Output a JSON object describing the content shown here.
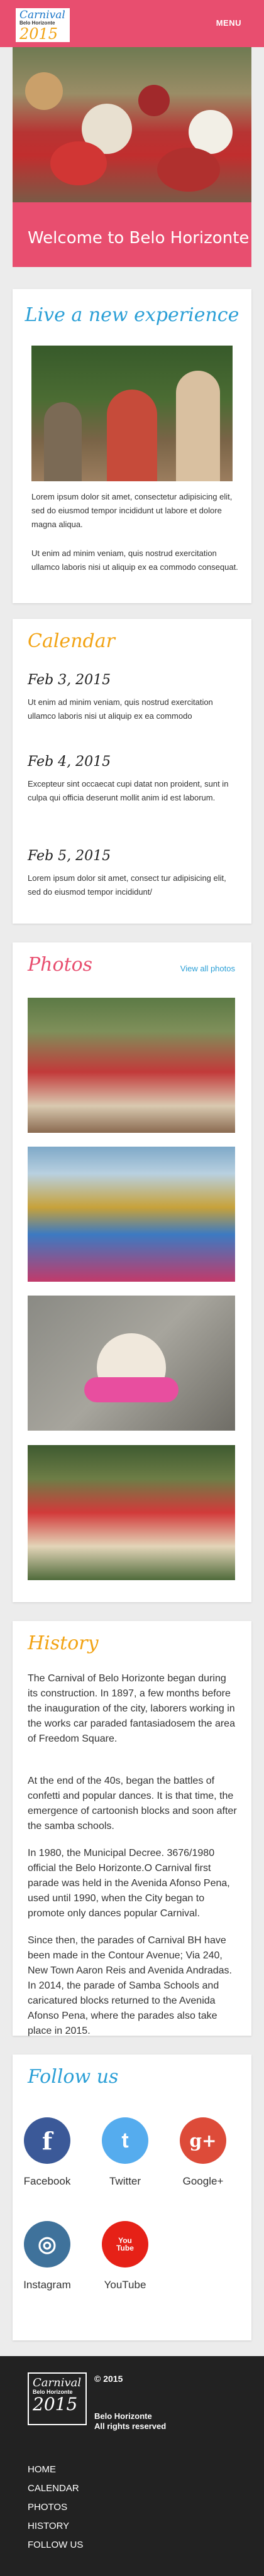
{
  "header": {
    "logo_line1": "Carnival",
    "logo_line2": "Belo Horizonte",
    "logo_line3": "2015",
    "menu_label": "MENU"
  },
  "hero": {
    "title": "Welcome to Belo Horizonte"
  },
  "live": {
    "title": "Live a new experience",
    "paragraphs": [
      "Lorem ipsum dolor sit amet, consectetur adipisicing elit, sed do eiusmod tempor incididunt ut labore et dolore magna aliqua.",
      "Ut enim ad minim veniam, quis nostrud exercitation ullamco laboris nisi ut aliquip ex ea commodo consequat."
    ]
  },
  "calendar": {
    "title": "Calendar",
    "events": [
      {
        "date": "Feb 3, 2015",
        "text": "Ut enim ad minim veniam, quis nostrud exercitation ullamco laboris nisi ut aliquip ex ea commodo"
      },
      {
        "date": "Feb 4, 2015",
        "text": "Excepteur sint occaecat cupi datat non proident, sunt in culpa qui officia deserunt mollit anim id est laborum."
      },
      {
        "date": "Feb 5, 2015",
        "text": "Lorem ipsum dolor sit amet, consect tur adipisicing elit, sed do eiusmod tempor incididunt/"
      }
    ]
  },
  "photos": {
    "title": "Photos",
    "view_all": "View all photos"
  },
  "history": {
    "title": "History",
    "paragraphs": [
      "The Carnival of Belo Horizonte began during its construction. In 1897, a few months before the inauguration of the city, laborers working in the works car paraded fantasiadosem the area of Freedom Square.",
      "At the end of the 40s, began the battles of confetti and popular dances. It is that time, the emergence of cartoonish blocks and soon after the samba schools.",
      "In 1980, the Municipal Decree. 3676/1980 official the Belo Horizonte.O Carnival first parade was held in the Avenida Afonso Pena, used until 1990, when the City began to promote only dances popular Carnival.",
      "Since then, the parades of Carnival BH have been made in the Contour Avenue; Via 240, New Town Aaron Reis and Avenida Andradas. In 2014, the parade of Samba Schools and caricatured blocks returned to the Avenida Afonso Pena, where the parades also take place in 2015."
    ]
  },
  "follow": {
    "title": "Follow us",
    "networks": [
      {
        "label": "Facebook",
        "glyph": "f",
        "color": "#3b5998",
        "icon": "facebook-icon"
      },
      {
        "label": "Twitter",
        "glyph": "t",
        "color": "#55acee",
        "icon": "twitter-icon"
      },
      {
        "label": "Google+",
        "glyph": "g+",
        "color": "#dd4b39",
        "icon": "google-plus-icon"
      },
      {
        "label": "Instagram",
        "glyph": "◎",
        "color": "#3f729b",
        "icon": "instagram-icon"
      },
      {
        "label": "YouTube",
        "glyph": "You Tube",
        "color": "#e62117",
        "icon": "youtube-icon"
      }
    ]
  },
  "footer": {
    "logo_line1": "Carnival",
    "logo_line2": "Belo Horizonte",
    "logo_line3": "2015",
    "copyright": "© 2015",
    "city": "Belo Horizonte",
    "rights": "All rights reserved",
    "nav": [
      "HOME",
      "CALENDAR",
      "PHOTOS",
      "HISTORY",
      "FOLLOW US"
    ]
  }
}
